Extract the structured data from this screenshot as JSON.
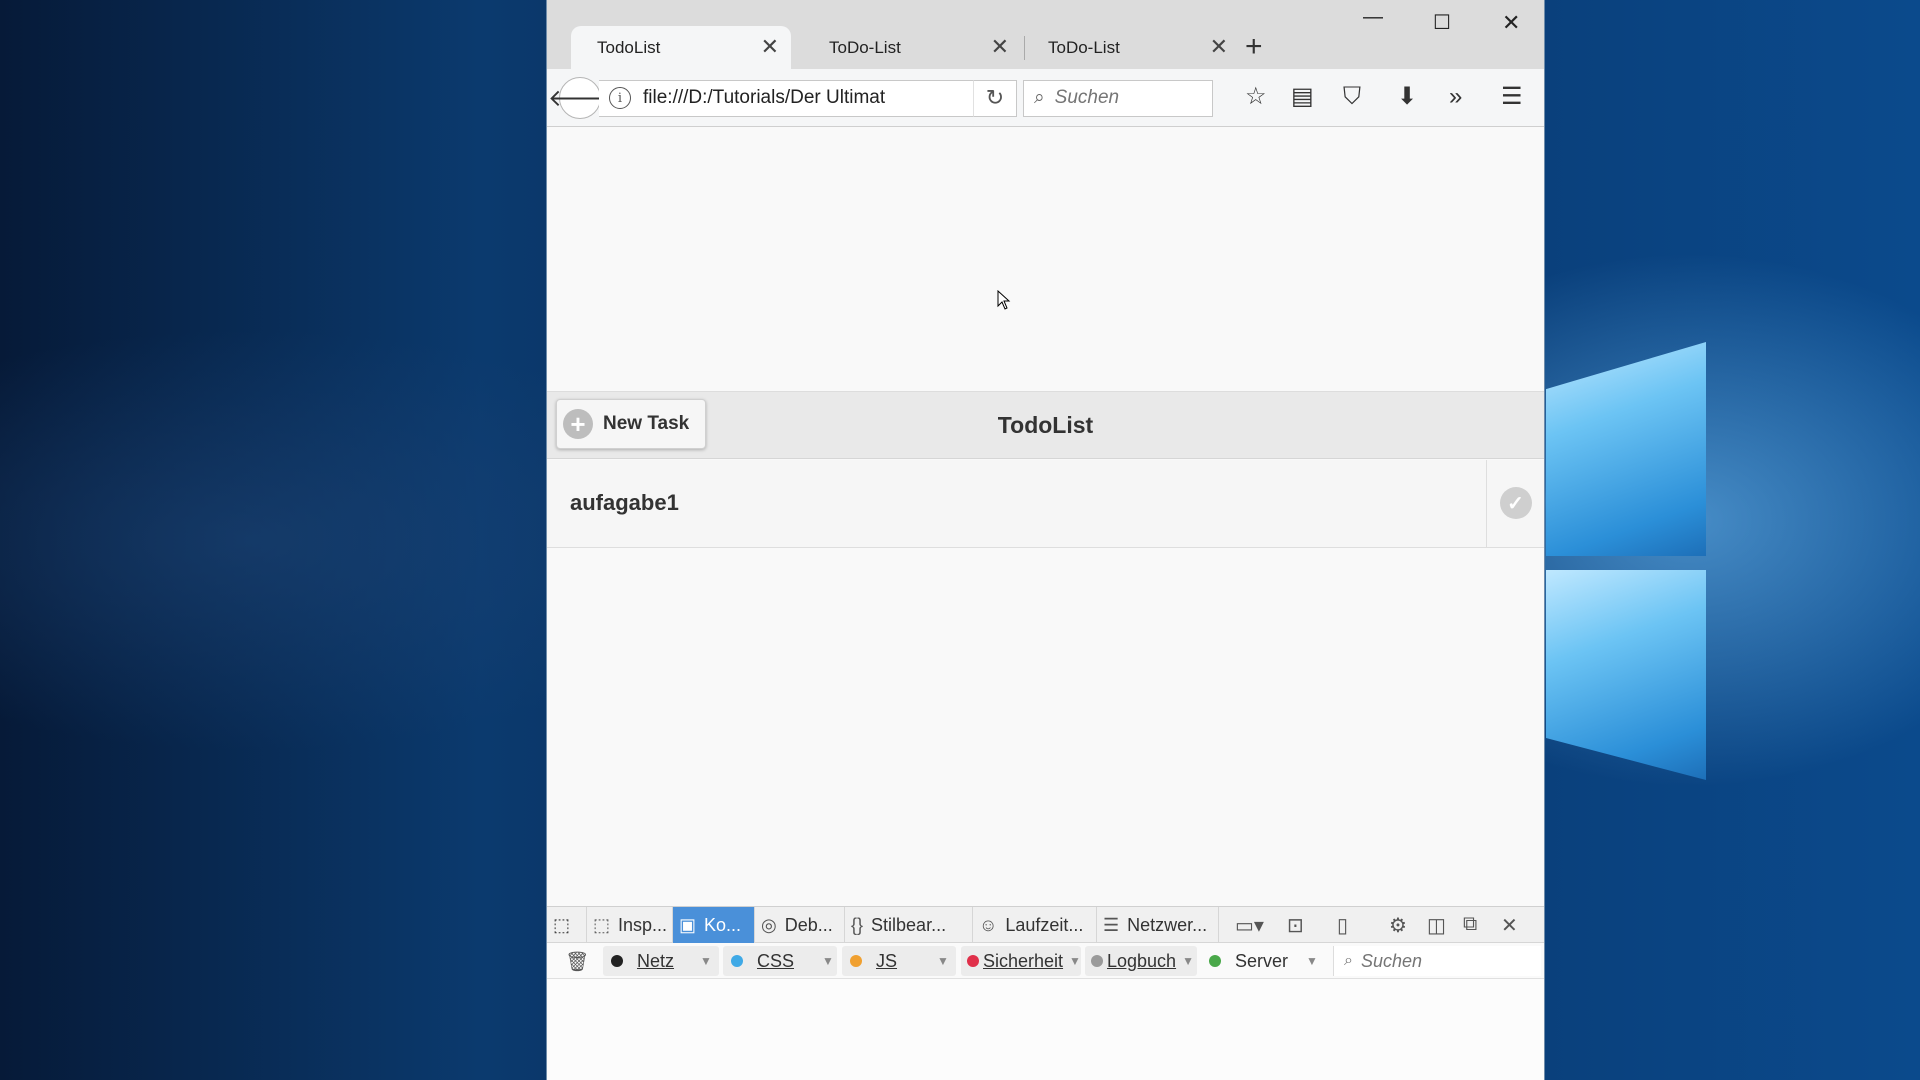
{
  "browser": {
    "tabs": [
      {
        "title": "TodoList",
        "active": true
      },
      {
        "title": "ToDo-List",
        "active": false
      },
      {
        "title": "ToDo-List",
        "active": false
      }
    ],
    "url": "file:///D:/Tutorials/Der Ultimat",
    "search_placeholder": "Suchen"
  },
  "app": {
    "title": "TodoList",
    "new_task_label": "New Task",
    "tasks": [
      {
        "label": "aufagabe1"
      }
    ]
  },
  "devtools": {
    "tabs": [
      {
        "label": "Insp...",
        "icon": "inspector-icon"
      },
      {
        "label": "Ko...",
        "icon": "console-icon",
        "active": true
      },
      {
        "label": "Deb...",
        "icon": "debugger-icon"
      },
      {
        "label": "Stilbear...",
        "icon": "style-editor-icon"
      },
      {
        "label": "Laufzeit...",
        "icon": "performance-icon"
      },
      {
        "label": "Netzwer...",
        "icon": "network-icon"
      }
    ],
    "filters": [
      {
        "label": "Netz",
        "color": "#222222"
      },
      {
        "label": "CSS",
        "color": "#3fa9e6"
      },
      {
        "label": "JS",
        "color": "#f0a030"
      },
      {
        "label": "Sicherheit",
        "color": "#e0304a"
      },
      {
        "label": "Logbuch",
        "color": "#9a9a9a"
      },
      {
        "label": "Server",
        "color": "#4aa84a"
      }
    ],
    "search_placeholder": "Suchen"
  },
  "colors": {
    "devtools_active_tab": "#4a90d9"
  }
}
